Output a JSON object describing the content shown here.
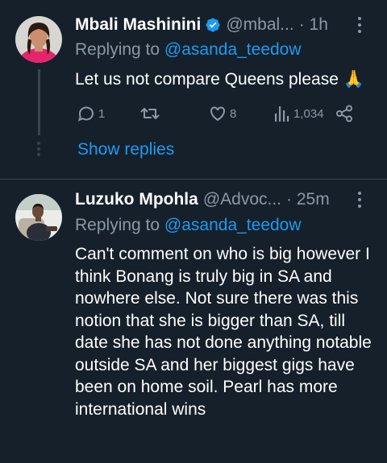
{
  "tweets": [
    {
      "name": "Mbali Mashinini",
      "handle": "@mbal...",
      "time": "· 1h",
      "replying_prefix": "Replying to ",
      "replying_to": "@asanda_teedow",
      "text": "Let us not compare Queens please 🙏",
      "reply_count": "1",
      "retweet_count": "",
      "like_count": "8",
      "view_count": "1,034",
      "verified": true
    },
    {
      "name": "Luzuko Mpohla",
      "handle": "@Advoc...",
      "time": "· 25m",
      "replying_prefix": "Replying to ",
      "replying_to": "@asanda_teedow",
      "text": "Can't comment on who is big however I think Bonang is truly big in SA and nowhere else. Not sure there was this notion that she is bigger than SA, till date she has not done anything notable outside SA and her biggest gigs have been on home soil. Pearl has more international wins",
      "verified": false
    }
  ],
  "show_replies_label": "Show replies",
  "colors": {
    "background": "#15202b",
    "accent": "#1d9bf0",
    "muted": "#8b98a5",
    "divider": "#38444d"
  },
  "icons": {
    "verified": "verified-badge-icon",
    "more": "more-options-icon",
    "reply": "reply-icon",
    "retweet": "retweet-icon",
    "like": "like-icon",
    "views": "views-icon",
    "share": "share-icon"
  }
}
